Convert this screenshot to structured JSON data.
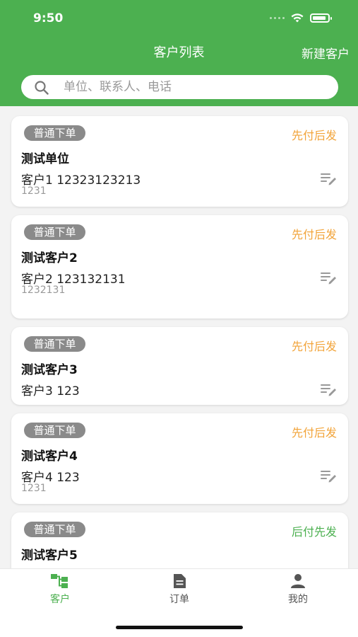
{
  "status_bar": {
    "time": "9:50"
  },
  "header": {
    "title": "客户列表",
    "action_label": "新建客户"
  },
  "search": {
    "placeholder": "单位、联系人、电话"
  },
  "customers": [
    {
      "badge": "普通下单",
      "pay_mode": "先付后发",
      "company": "测试单位",
      "contact": "客户1  12323123213",
      "address": "1231"
    },
    {
      "badge": "普通下单",
      "pay_mode": "先付后发",
      "company": "测试客户2",
      "contact": "客户2  123132131",
      "address": "1232131"
    },
    {
      "badge": "普通下单",
      "pay_mode": "先付后发",
      "company": "测试客户3",
      "contact": "客户3  123",
      "address": ""
    },
    {
      "badge": "普通下单",
      "pay_mode": "先付后发",
      "company": "测试客户4",
      "contact": "客户4  123",
      "address": "1231"
    },
    {
      "badge": "普通下单",
      "pay_mode": "后付先发",
      "company": "测试客户5",
      "contact": "",
      "address": ""
    }
  ],
  "tabs": [
    {
      "label": "客户",
      "icon": "customers-icon",
      "active": true
    },
    {
      "label": "订单",
      "icon": "orders-icon",
      "active": false
    },
    {
      "label": "我的",
      "icon": "profile-icon",
      "active": false
    }
  ],
  "colors": {
    "primary": "#4cb050",
    "badge_bg": "#8a8a8a",
    "pay_first": "#f2a43a",
    "pay_later": "#4cb050"
  }
}
